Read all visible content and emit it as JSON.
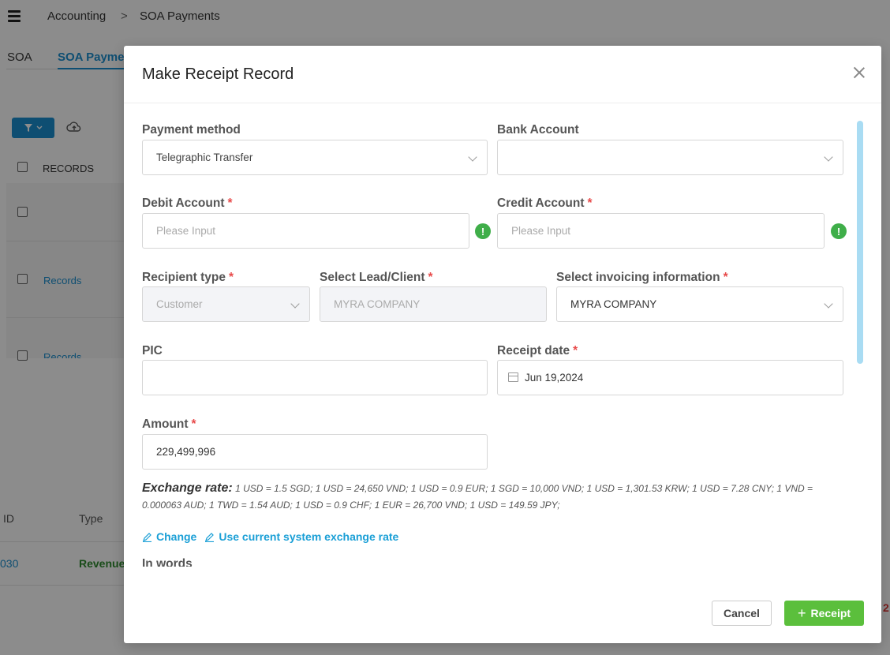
{
  "app": {
    "breadcrumb": [
      "Accounting",
      ">",
      "SOA Payments"
    ],
    "tabs": [
      "SOA",
      "SOA Payme"
    ],
    "records_header": "RECORDS",
    "records_rows": [
      "Records",
      "Records"
    ],
    "table_headers": [
      "ID",
      "Type"
    ],
    "table_row": {
      "id": "030",
      "type": "Revenue"
    },
    "right_edge_text": "2"
  },
  "modal": {
    "title": "Make Receipt Record",
    "fields": {
      "payment_method": {
        "label": "Payment method",
        "value": "Telegraphic Transfer"
      },
      "bank_account": {
        "label": "Bank Account",
        "value": ""
      },
      "debit_account": {
        "label": "Debit Account",
        "required": "*",
        "placeholder": "Please Input"
      },
      "credit_account": {
        "label": "Credit Account",
        "required": "*",
        "placeholder": "Please Input"
      },
      "recipient_type": {
        "label": "Recipient type",
        "required": "*",
        "value": "Customer"
      },
      "lead_client": {
        "label": "Select Lead/Client",
        "required": "*",
        "value": "MYRA COMPANY"
      },
      "invoicing_info": {
        "label": "Select invoicing information",
        "required": "*",
        "value": "MYRA COMPANY"
      },
      "pic": {
        "label": "PIC",
        "value": ""
      },
      "receipt_date": {
        "label": "Receipt date",
        "required": "*",
        "value": "Jun 19,2024"
      },
      "amount": {
        "label": "Amount",
        "required": "*",
        "value": "229,499,996"
      }
    },
    "exchange_rate": {
      "label": "Exchange rate:",
      "text": "1 USD = 1.5 SGD; 1 USD = 24,650 VND; 1 USD = 0.9 EUR; 1 SGD = 10,000 VND; 1 USD = 1,301.53 KRW; 1 USD = 7.28 CNY; 1 VND = 0.000063 AUD; 1 TWD = 1.54 AUD; 1 USD = 0.9 CHF; 1 EUR = 26,700 VND; 1 USD = 149.59 JPY;"
    },
    "links": {
      "change": "Change",
      "use_system_rate": "Use current system exchange rate"
    },
    "in_words_label": "In words",
    "buttons": {
      "cancel": "Cancel",
      "receipt": "Receipt"
    },
    "warn_glyph": "!",
    "colors": {
      "primary": "#1a8fd0",
      "success": "#5bbf3c",
      "required": "#e84b4b",
      "warn": "#3fae49"
    }
  }
}
